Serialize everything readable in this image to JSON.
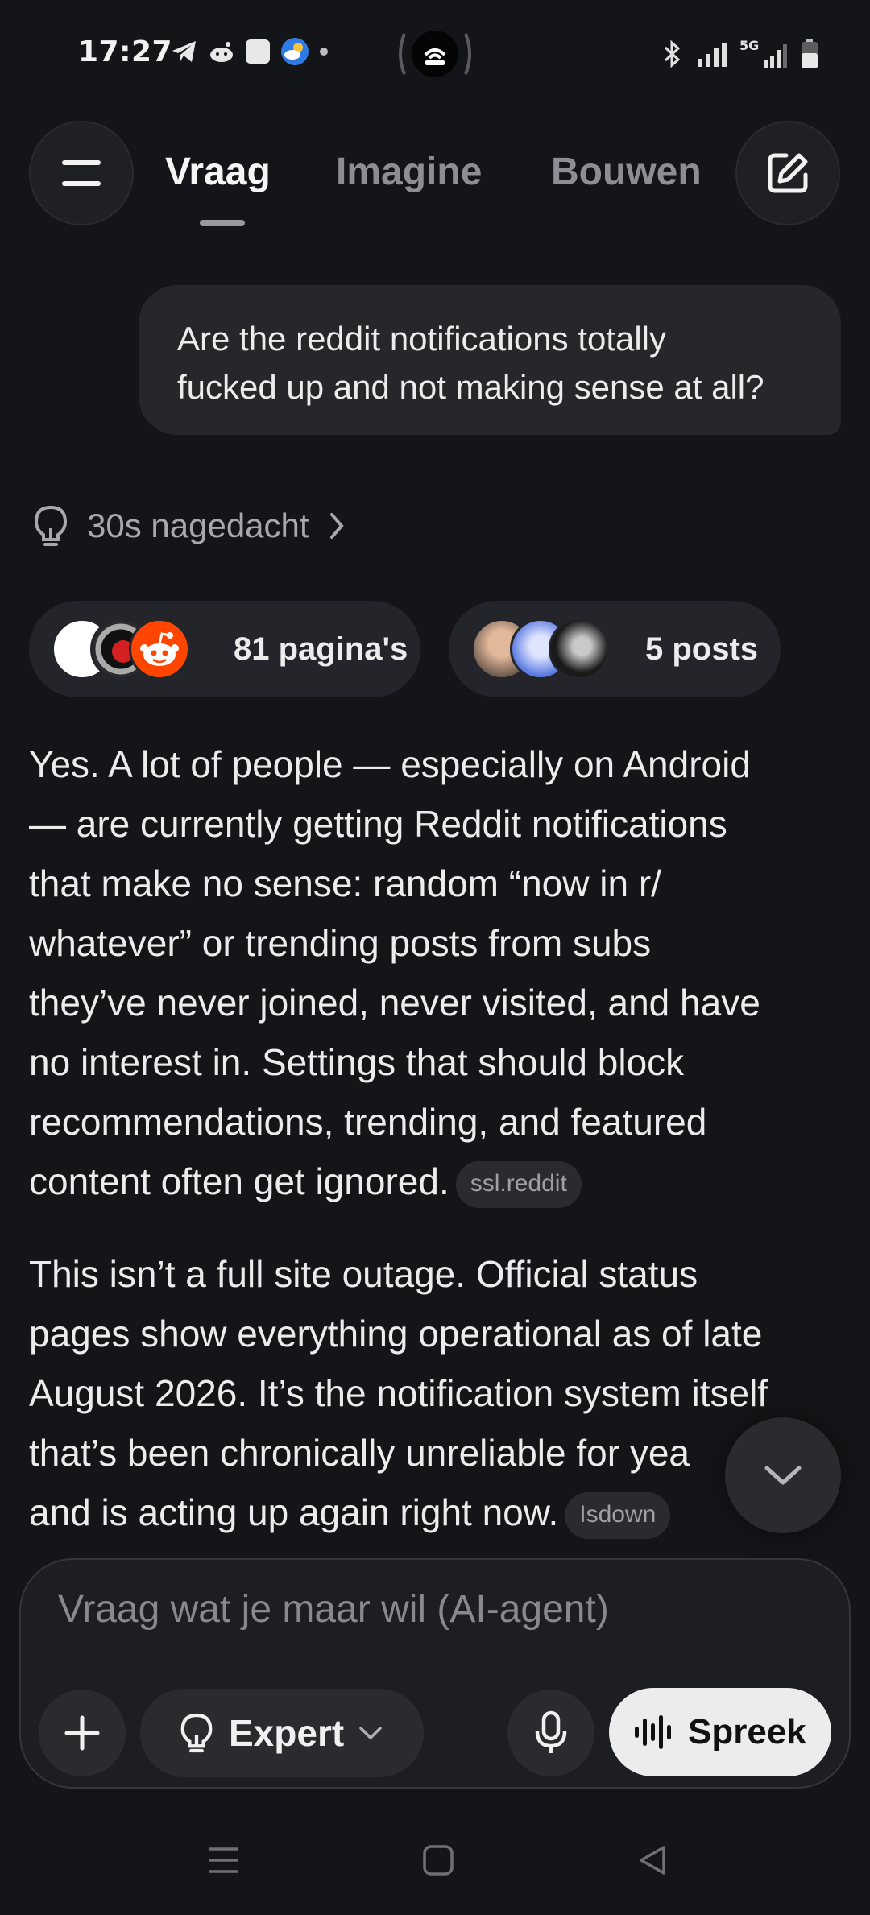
{
  "status_bar": {
    "time": "17:27",
    "network_label": "5G"
  },
  "nav": {
    "tabs": [
      {
        "label": "Vraag",
        "active": true
      },
      {
        "label": "Imagine",
        "active": false
      },
      {
        "label": "Bouwen",
        "active": false
      }
    ],
    "menu_icon": "hamburger-menu-icon",
    "edit_icon": "new-chat-edit-icon"
  },
  "conversation": {
    "user_message_lines": [
      "Are the reddit notifications totally",
      "fucked up and not making sense at all?"
    ],
    "thought": {
      "label": "30s nagedacht",
      "icon": "lightbulb-icon"
    },
    "sources": {
      "pages_label": "81 pagina's",
      "posts_label": "5 posts"
    },
    "answer": {
      "p1_lines": [
        "Yes. A lot of people — especially on Android",
        "— are currently getting Reddit notifications",
        "that make no sense: random “now in r/",
        "whatever” or trending posts from subs",
        "they’ve never joined, never visited, and have",
        "no interest in. Settings that should block",
        "recommendations, trending, and featured",
        "content often get ignored."
      ],
      "p1_citation": "ssl.reddit",
      "p2_lines": [
        "This isn’t a full site outage. Official status",
        "pages show everything operational as of late",
        "August 2026. It’s the notification system itself",
        "that’s been chronically unreliable for yea",
        "and is acting up again right now."
      ],
      "p2_citation": "Isdown"
    }
  },
  "composer": {
    "placeholder": "Vraag wat je maar wil (AI-agent)",
    "mode_label": "Expert",
    "speak_label": "Spreek"
  },
  "colors": {
    "background": "#141518",
    "bubble": "#26272b",
    "chip": "#24252a",
    "reddit_orange": "#ff4500",
    "speak_button": "#ececec"
  }
}
